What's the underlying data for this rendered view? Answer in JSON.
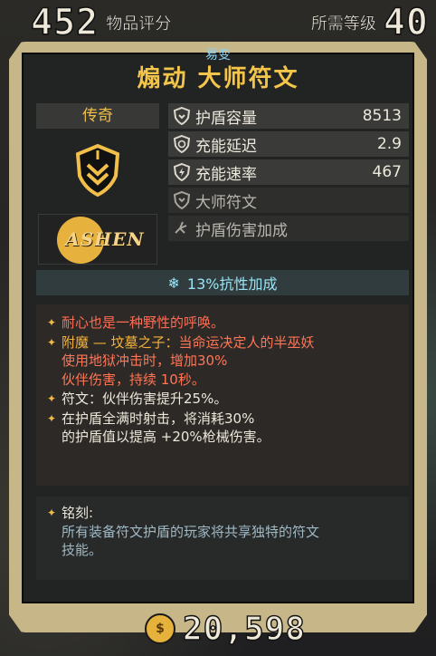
{
  "top": {
    "item_score": "452",
    "item_score_label": "物品评分",
    "required_level_label": "所需等级",
    "required_level": "40"
  },
  "item": {
    "prefix": "易变",
    "name": "煽动 大师符文",
    "rarity": "传奇",
    "brand": "ASHEN",
    "icon": "shield-chevron-icon"
  },
  "stats": [
    {
      "icon": "shield-capacity-icon",
      "label": "护盾容量",
      "value": "8513",
      "dim": false
    },
    {
      "icon": "recharge-delay-icon",
      "label": "充能延迟",
      "value": "2.9",
      "dim": false
    },
    {
      "icon": "recharge-rate-icon",
      "label": "充能速率",
      "value": "467",
      "dim": false
    },
    {
      "icon": "master-rune-icon",
      "label": "大师符文",
      "value": "",
      "dim": true
    },
    {
      "icon": "shield-damage-icon",
      "label": "护盾伤害加成",
      "value": "",
      "dim": true
    }
  ],
  "resist": {
    "icon": "snowflake-icon",
    "text": "13%抗性加成"
  },
  "description": {
    "line1": "耐心也是一种野性的呼唤。",
    "enchant_label": "附魔 — 坟墓之子：",
    "enchant_text_1": "当命运决定人的半巫妖",
    "enchant_text_2": "使用地狱冲击时，增加30%",
    "enchant_text_3": "伙伴伤害，持续 10秒。",
    "rune_label": "符文：",
    "rune_text": "伙伴伤害提升25%。",
    "line4_a": "在护盾全满时射击，将消耗30%",
    "line4_b": "的护盾值以提高 +20%枪械伤害。"
  },
  "inscription": {
    "title": "铭刻:",
    "text_1": "所有装备符文护盾的玩家将共享独特的符文",
    "text_2": "技能。"
  },
  "price": {
    "icon": "coin-icon",
    "value": "20,598"
  },
  "colors": {
    "frame": "#c7b687",
    "legendary": "#f3c54a",
    "accent_blue": "#8fd3f2",
    "enchant_red": "#ff6d55"
  }
}
